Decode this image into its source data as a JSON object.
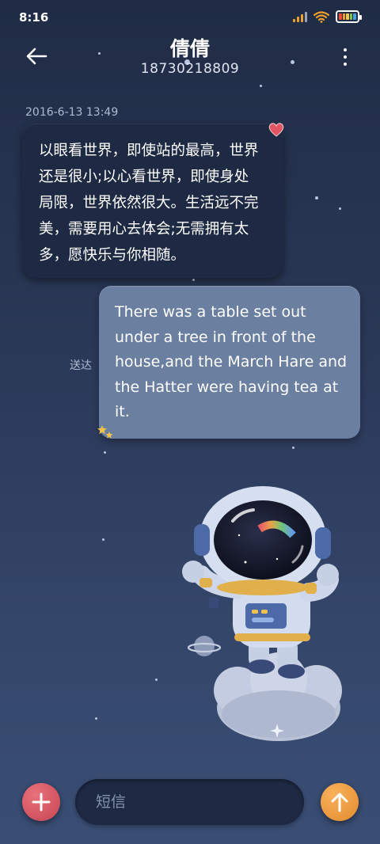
{
  "status_bar": {
    "time": "8:16",
    "icons": [
      "signal-icon",
      "wifi-icon",
      "battery-icon"
    ],
    "accent": "#f0a02a"
  },
  "header": {
    "back_icon": "back-arrow-icon",
    "contact_name": "倩倩",
    "contact_number": "18730218809",
    "more_icon": "more-vertical-icon"
  },
  "messages": [
    {
      "direction": "incoming",
      "timestamp": "2016-6-13 13:49",
      "lines": [
        "以眼看世界，即使站的最高，世界",
        "还是很小;以心看世界，即使身处",
        "局限，世界依然很大。生活远不完",
        "美，需要用心去体会;无需拥有太",
        "多，愿快乐与你相随。"
      ],
      "decoration": "heart-icon"
    },
    {
      "direction": "outgoing",
      "status": "送达",
      "lines": [
        "There was a table set out",
        "under a tree in front of the",
        "house,and the March Hare and",
        "the Hatter were having tea at",
        "it."
      ],
      "decoration": "stars-icon"
    }
  ],
  "composer": {
    "add_icon": "plus-icon",
    "placeholder": "短信",
    "value": "",
    "send_icon": "arrow-up-icon"
  },
  "colors": {
    "incoming_bubble": "#1e2a44",
    "outgoing_bubble": "#6b7fa0",
    "add_button": "#d85a66",
    "send_button": "#f0a040"
  }
}
